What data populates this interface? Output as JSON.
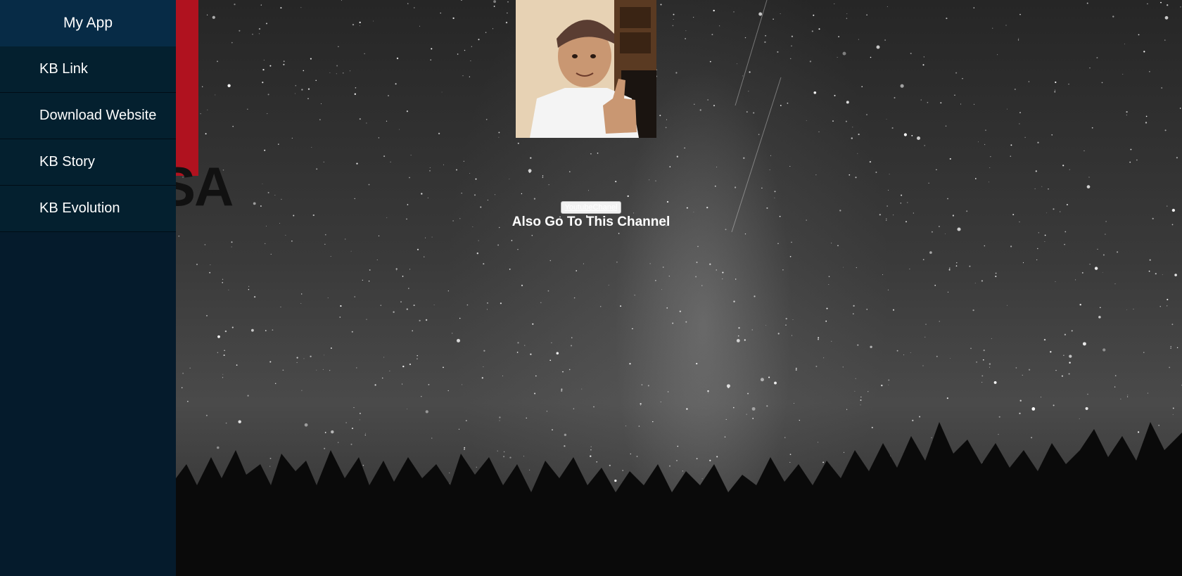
{
  "sidebar": {
    "title": "My App",
    "items": [
      {
        "label": "KB Link"
      },
      {
        "label": "Download Website"
      },
      {
        "label": "KB Story"
      },
      {
        "label": "KB Evolution"
      }
    ]
  },
  "banner": {
    "text": "SA",
    "color": "#b0121f"
  },
  "main": {
    "channel_button_label": "YoutubeChanel",
    "channel_text": "Also Go To This Channel"
  },
  "colors": {
    "sidebar_bg": "#051b2c",
    "sidebar_header_bg": "#072b46"
  }
}
